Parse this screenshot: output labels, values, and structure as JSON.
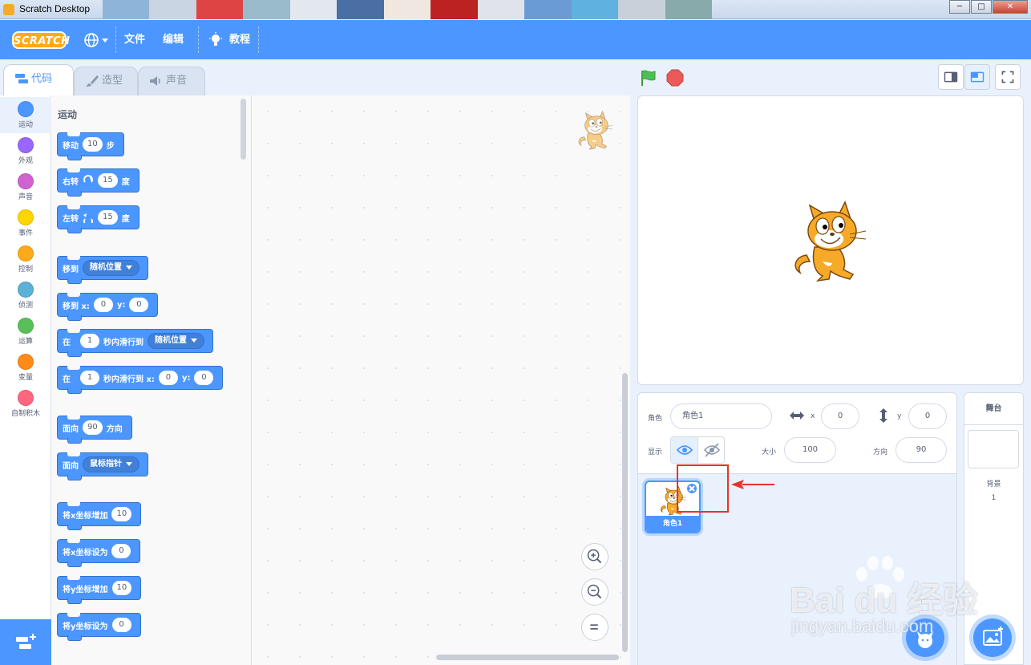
{
  "window": {
    "title": "Scratch Desktop",
    "minimize": "─",
    "maximize": "□",
    "close": "✕"
  },
  "menu": {
    "logo": "SCRATCH",
    "file": "文件",
    "edit": "编辑",
    "tutorials": "教程"
  },
  "tabs": {
    "code": "代码",
    "costumes": "造型",
    "sounds": "声音"
  },
  "categories": [
    {
      "label": "运动",
      "color": "#4c97ff"
    },
    {
      "label": "外观",
      "color": "#9966ff"
    },
    {
      "label": "声音",
      "color": "#cf63cf"
    },
    {
      "label": "事件",
      "color": "#ffd500"
    },
    {
      "label": "控制",
      "color": "#ffab19"
    },
    {
      "label": "侦测",
      "color": "#5cb1d6"
    },
    {
      "label": "运算",
      "color": "#59c059"
    },
    {
      "label": "变量",
      "color": "#ff8c1a"
    },
    {
      "label": "自制积木",
      "color": "#ff6680"
    }
  ],
  "palette": {
    "title": "运动",
    "blocks": {
      "move": {
        "a": "移动",
        "v": "10",
        "b": "步"
      },
      "turn_right": {
        "a": "右转",
        "v": "15",
        "b": "度"
      },
      "turn_left": {
        "a": "左转",
        "v": "15",
        "b": "度"
      },
      "goto": {
        "a": "移到",
        "dd": "随机位置"
      },
      "goto_xy": {
        "a": "移到 x:",
        "x": "0",
        "b": "y:",
        "y": "0"
      },
      "glide": {
        "a": "在",
        "v": "1",
        "b": "秒内滑行到",
        "dd": "随机位置"
      },
      "glide_xy": {
        "a": "在",
        "v": "1",
        "b": "秒内滑行到 x:",
        "x": "0",
        "c": "y:",
        "y": "0"
      },
      "point_dir": {
        "a": "面向",
        "v": "90",
        "b": "方向"
      },
      "point_towards": {
        "a": "面向",
        "dd": "鼠标指针"
      },
      "change_x": {
        "a": "将x坐标增加",
        "v": "10"
      },
      "set_x": {
        "a": "将x坐标设为",
        "v": "0"
      },
      "change_y": {
        "a": "将y坐标增加",
        "v": "10"
      },
      "set_y": {
        "a": "将y坐标设为",
        "v": "0"
      }
    }
  },
  "sprite_info": {
    "sprite_label": "角色",
    "sprite_name": "角色1",
    "x_label": "x",
    "x_value": "0",
    "y_label": "y",
    "y_value": "0",
    "show_label": "显示",
    "size_label": "大小",
    "size_value": "100",
    "direction_label": "方向",
    "direction_value": "90"
  },
  "sprites": [
    {
      "name": "角色1"
    }
  ],
  "stage_pane": {
    "title": "舞台",
    "backdrops_label": "背景",
    "backdrops_count": "1"
  },
  "watermark": {
    "brand": "Bai du 经验",
    "url": "jingyan.baidu.com"
  }
}
